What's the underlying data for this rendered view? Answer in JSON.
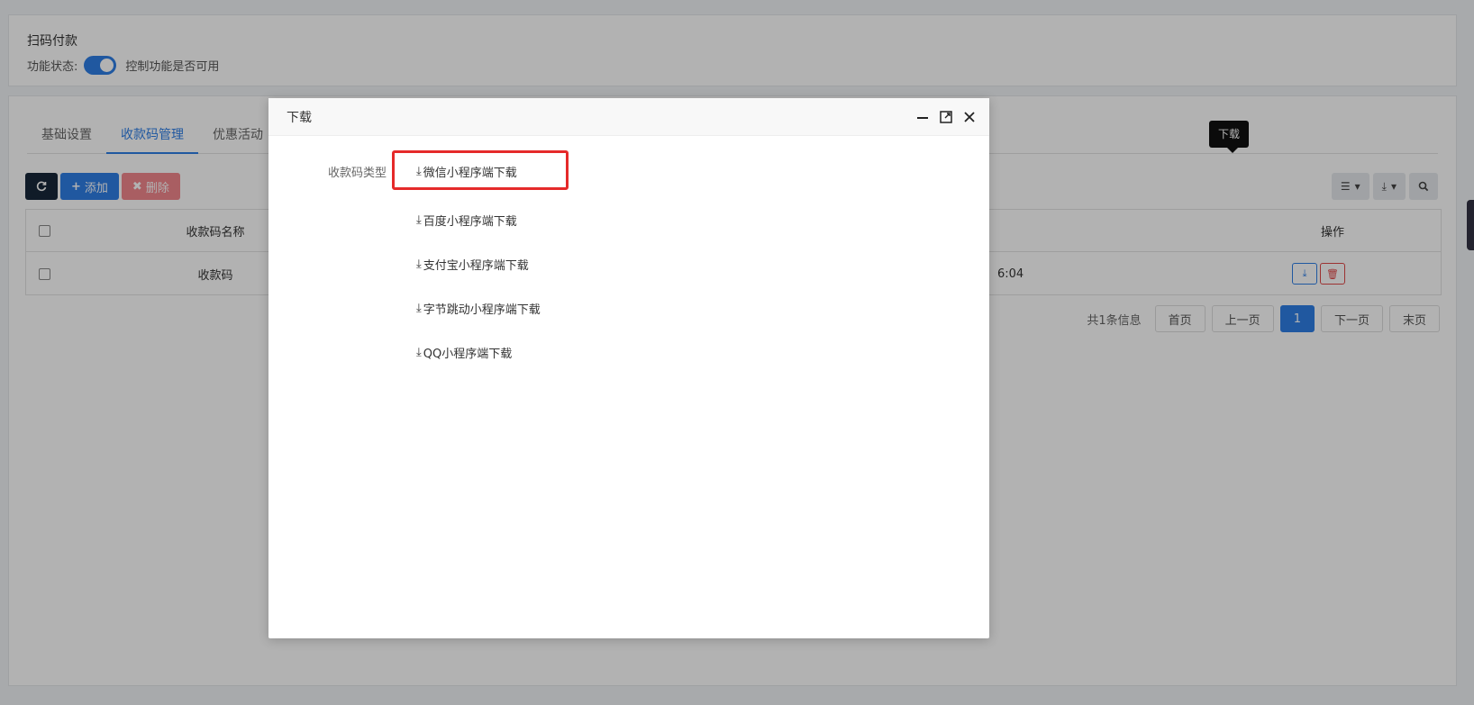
{
  "feature": {
    "title": "扫码付款",
    "status_label": "功能状态:",
    "status_desc": "控制功能是否可用"
  },
  "tabs": [
    {
      "label": "基础设置"
    },
    {
      "label": "收款码管理"
    },
    {
      "label": "优惠活动"
    }
  ],
  "toolbar": {
    "add_label": "添加",
    "delete_label": "删除"
  },
  "table": {
    "header_name": "收款码名称",
    "header_ops": "操作",
    "row_name": "收款码",
    "row_time_partial": "6:04"
  },
  "tooltip": "下载",
  "pager": {
    "info": "共1条信息",
    "first": "首页",
    "prev": "上一页",
    "current": "1",
    "next": "下一页",
    "last": "末页"
  },
  "modal": {
    "title": "下载",
    "type_label": "收款码类型",
    "items": [
      {
        "label": "微信小程序端下载"
      },
      {
        "label": "百度小程序端下载"
      },
      {
        "label": "支付宝小程序端下载"
      },
      {
        "label": "字节跳动小程序端下载"
      },
      {
        "label": "QQ小程序端下载"
      }
    ]
  },
  "colors": {
    "primary": "#2e7ee6",
    "danger": "#e52a2a"
  }
}
